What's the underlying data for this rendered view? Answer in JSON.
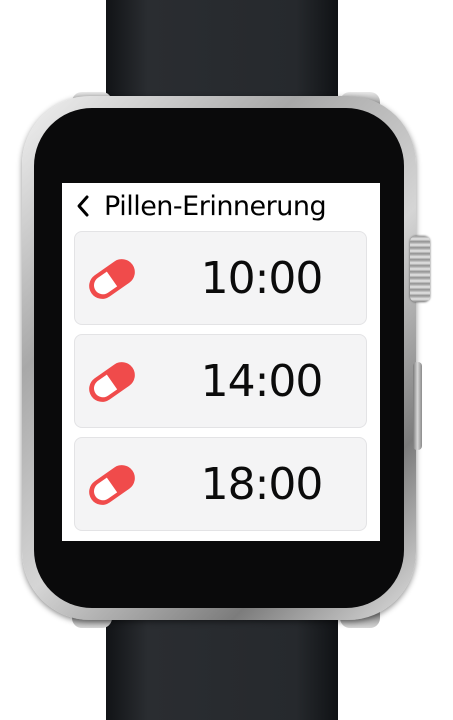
{
  "header": {
    "back_icon": "chevron-left-icon",
    "title": "Pillen-Erinnerung"
  },
  "reminders": [
    {
      "time": "10:00",
      "icon": "pill-icon"
    },
    {
      "time": "14:00",
      "icon": "pill-icon"
    },
    {
      "time": "18:00",
      "icon": "pill-icon"
    }
  ],
  "colors": {
    "accent": "#f04b4b",
    "card_background": "#f4f4f5",
    "screen_background": "#ffffff",
    "text": "#000000"
  }
}
